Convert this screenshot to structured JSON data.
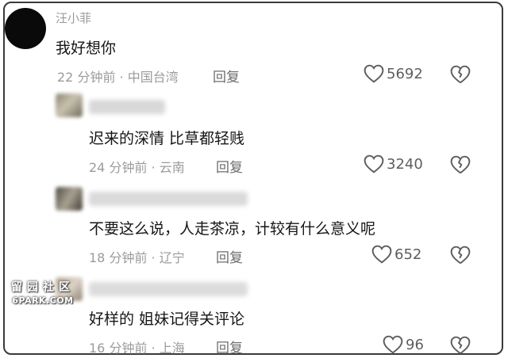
{
  "comments": [
    {
      "username": "汪小菲",
      "text": "我好想你",
      "time_location": "22 分钟前 · 中国台湾",
      "reply_label": "回复",
      "likes": "5692"
    },
    {
      "username": "",
      "text": "迟来的深情  比草都轻贱",
      "time_location": "24 分钟前 · 云南",
      "reply_label": "回复",
      "likes": "3240"
    },
    {
      "username": "",
      "text": "不要这么说，人走茶凉，计较有什么意义呢",
      "time_location": "18 分钟前 · 辽宁",
      "reply_label": "回复",
      "likes": "652"
    },
    {
      "username": "",
      "text": "好样的 姐妹记得关评论",
      "time_location": "16 分钟前 · 上海",
      "reply_label": "回复",
      "likes": "96"
    }
  ],
  "watermark": {
    "line1": "留园社区",
    "line2": "6PARK.COM"
  },
  "icons": {
    "like": "heart-outline-icon",
    "dislike": "broken-heart-icon"
  },
  "colors": {
    "text_primary": "#161616",
    "text_meta": "#9b9b9b",
    "icon": "#5e5e5e"
  }
}
